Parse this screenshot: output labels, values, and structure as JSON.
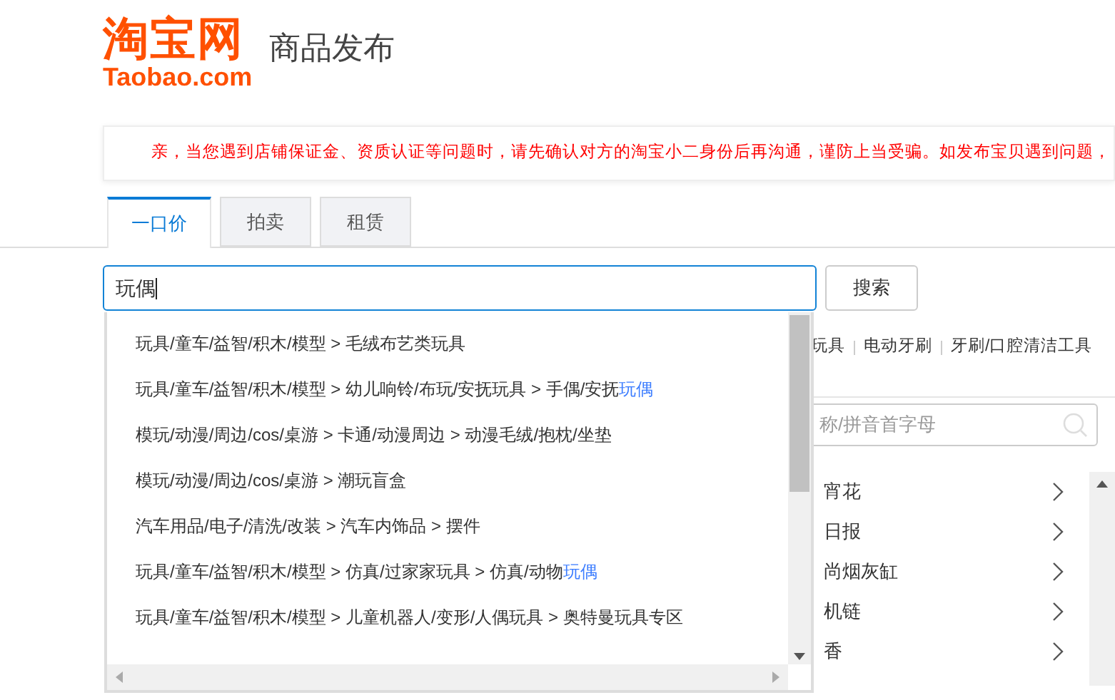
{
  "header": {
    "logo_mark": "淘宝网",
    "logo_domain": "Taobao.com",
    "title": "商品发布"
  },
  "notice": "亲，当您遇到店铺保证金、资质认证等问题时，请先确认对方的淘宝小二身份后再沟通，谨防上当受骗。如发布宝贝遇到问题，",
  "tabs": [
    {
      "label": "一口价",
      "selected": true
    },
    {
      "label": "拍卖",
      "selected": false
    },
    {
      "label": "租赁",
      "selected": false
    }
  ],
  "search": {
    "value": "玩偶",
    "button": "搜索"
  },
  "suggestions": [
    {
      "text": "玩具/童车/益智/积木/模型 > 毛绒布艺类玩具"
    },
    {
      "text": "玩具/童车/益智/积木/模型 > 幼儿响铃/布玩/安抚玩具 > 手偶/安抚",
      "match": "玩偶"
    },
    {
      "text": "模玩/动漫/周边/cos/桌游 > 卡通/动漫周边 > 动漫毛绒/抱枕/坐垫"
    },
    {
      "text": "模玩/动漫/周边/cos/桌游 > 潮玩盲盒"
    },
    {
      "text": "汽车用品/电子/清洗/改装 > 汽车内饰品 > 摆件"
    },
    {
      "text": "玩具/童车/益智/积木/模型 > 仿真/过家家玩具 > 仿真/动物",
      "match": "玩偶"
    },
    {
      "text": "玩具/童车/益智/积木/模型 > 儿童机器人/变形/人偶玩具 > 奥特曼玩具专区"
    }
  ],
  "hot_keywords": [
    "玩具",
    "电动牙刷",
    "牙刷/口腔清洁工具"
  ],
  "category_panel": {
    "placeholder": "称/拼音首字母",
    "items": [
      "宵花",
      "日报",
      "尚烟灰缸",
      "机链",
      "香"
    ]
  }
}
